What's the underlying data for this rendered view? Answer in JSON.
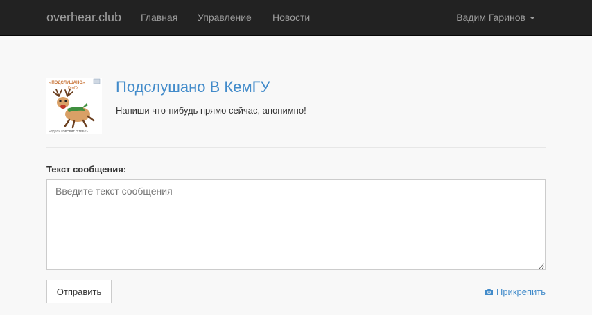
{
  "navbar": {
    "brand": "overhear.club",
    "links": [
      "Главная",
      "Управление",
      "Новости"
    ],
    "user": "Вадим Гаринов"
  },
  "group": {
    "title": "Подслушано В КемГУ",
    "description": "Напиши что-нибудь прямо сейчас, анонимно!",
    "logo": {
      "top_text": "«ПОДСЛУШАНО»",
      "sub_text": "КемГУ",
      "bottom_text": "«ЗДЕСЬ ГОВОРЯТ О ТЕБЕ»"
    }
  },
  "form": {
    "label": "Текст сообщения:",
    "placeholder": "Введите текст сообщения",
    "value": "",
    "submit_label": "Отправить",
    "attach_label": "Прикрепить"
  },
  "colors": {
    "navbar_bg": "#222222",
    "link": "#428bca",
    "page_bg": "#f8f8f8"
  }
}
